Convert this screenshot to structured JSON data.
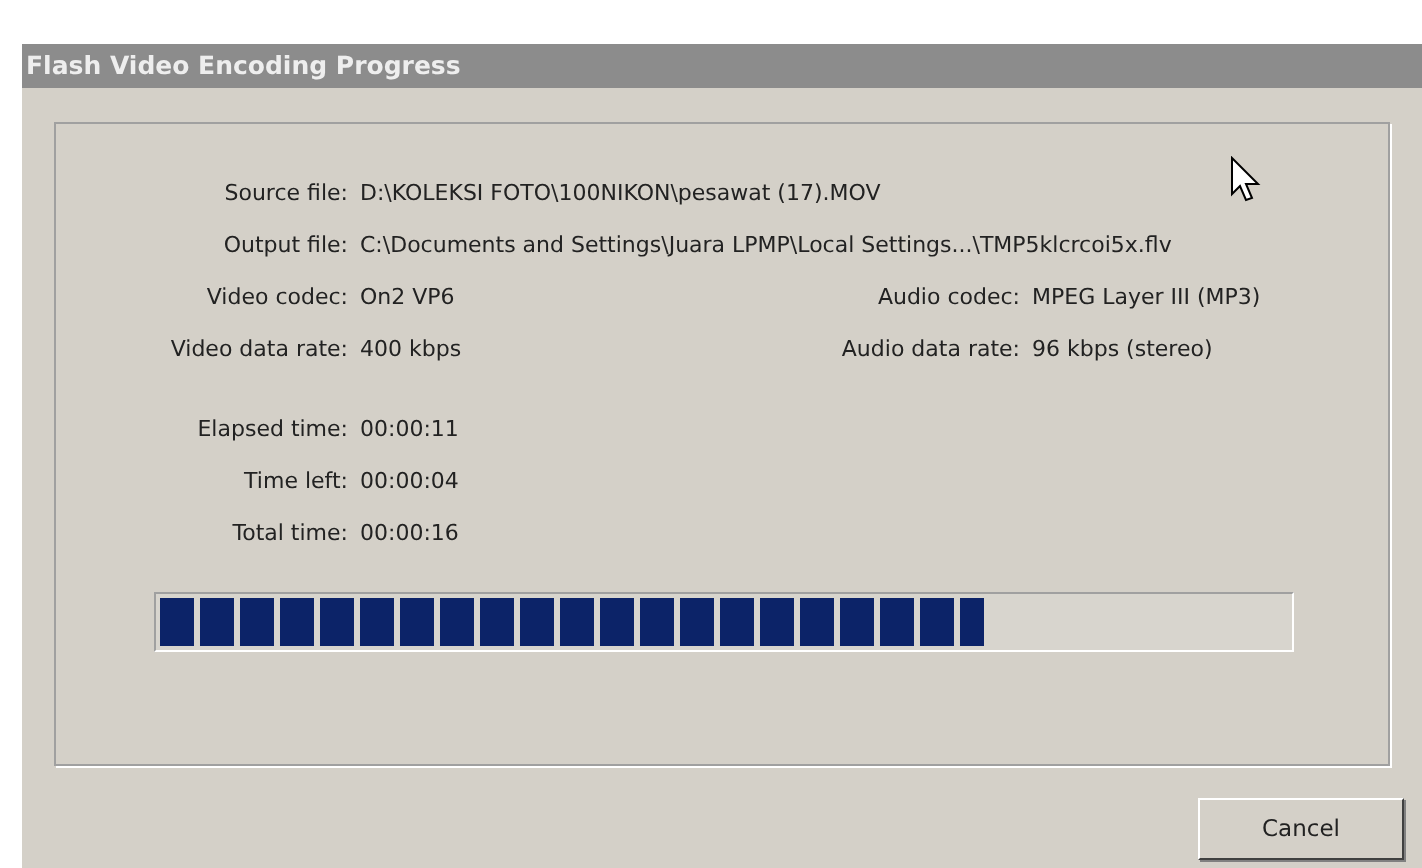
{
  "window": {
    "title": "Flash Video Encoding Progress"
  },
  "file_rows": [
    {
      "label": "Source file:",
      "value": "D:\\KOLEKSI FOTO\\100NIKON\\pesawat (17).MOV"
    },
    {
      "label": "Output file:",
      "value": "C:\\Documents and Settings\\Juara LPMP\\Local Settings...\\TMP5klcrcoi5x.flv"
    }
  ],
  "codec_rows": [
    {
      "label": "Video codec:",
      "value": "On2 VP6",
      "right_label": "Audio codec:",
      "right_value": "MPEG Layer III (MP3)"
    },
    {
      "label": "Video data rate:",
      "value": "400 kbps",
      "right_label": "Audio data rate:",
      "right_value": "96 kbps (stereo)"
    }
  ],
  "time_rows": [
    {
      "label": "Elapsed time:",
      "value": "00:00:11"
    },
    {
      "label": "Time left:",
      "value": "00:00:04"
    },
    {
      "label": "Total time:",
      "value": "00:00:16"
    }
  ],
  "progress": {
    "level": 0.73
  },
  "buttons": [
    "Cancel"
  ]
}
